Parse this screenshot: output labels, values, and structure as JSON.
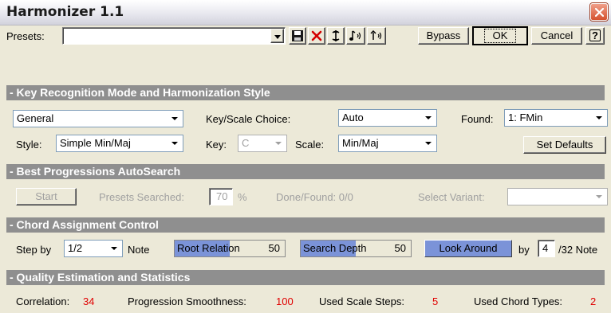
{
  "window": {
    "title": "Harmonizer 1.1"
  },
  "presets": {
    "label": "Presets:",
    "value": "",
    "bypass_label": "Bypass",
    "ok_label": "OK",
    "cancel_label": "Cancel",
    "help_label": "?"
  },
  "key_section": {
    "header": "- Key Recognition Mode and Harmonization Style",
    "mode_value": "General",
    "key_scale_choice_label": "Key/Scale Choice:",
    "key_scale_choice_value": "Auto",
    "found_label": "Found:",
    "found_value": "1: FMin",
    "style_label": "Style:",
    "style_value": "Simple Min/Maj",
    "key_label": "Key:",
    "key_value": "C",
    "scale_label": "Scale:",
    "scale_value": "Min/Maj",
    "set_defaults_label": "Set Defaults"
  },
  "autosearch_section": {
    "header": "- Best Progressions AutoSearch",
    "start_label": "Start",
    "presets_searched_label": "Presets Searched:",
    "presets_searched_value": "70",
    "percent_symbol": "%",
    "done_found_label": "Done/Found: 0/0",
    "select_variant_label": "Select Variant:",
    "select_variant_value": ""
  },
  "chord_section": {
    "header": "- Chord Assignment Control",
    "step_by_label": "Step by",
    "step_value": "1/2",
    "note_label": "Note",
    "root_relation_label": "Root Relation",
    "root_relation_value": "50",
    "search_depth_label": "Search Depth",
    "search_depth_value": "50",
    "look_around_label": "Look Around",
    "by_label": "by",
    "look_around_value": "4",
    "per32_label": "/32 Note",
    "slider_fill": {
      "root_relation": 0.5,
      "search_depth": 0.5
    }
  },
  "stats_section": {
    "header": "- Quality Estimation and Statistics",
    "correlation_label": "Correlation:",
    "correlation_value": "34",
    "smoothness_label": "Progression Smoothness:",
    "smoothness_value": "100",
    "scale_steps_label": "Used Scale Steps:",
    "scale_steps_value": "5",
    "chord_types_label": "Used Chord Types:",
    "chord_types_value": "2"
  },
  "icons": [
    "close-icon",
    "save-icon",
    "delete-icon",
    "refresh-icon",
    "midi-note-icon",
    "midi-input-icon",
    "help-icon",
    "dropdown-arrow-icon"
  ],
  "colors": {
    "section_header": "#8f8f8f",
    "accent_blue": "#7b93d8",
    "value_red": "#e00000",
    "close_button": "#d5522f"
  }
}
